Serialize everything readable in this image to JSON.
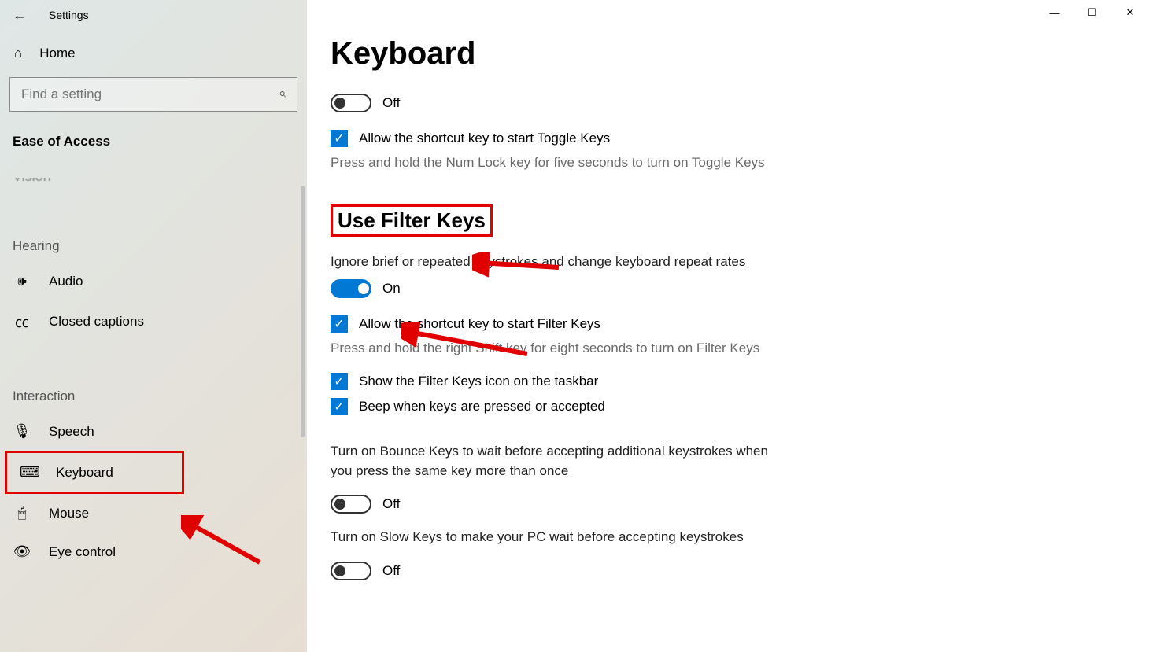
{
  "window": {
    "title": "Settings",
    "minimize": "—",
    "maximize": "☐",
    "close": "✕"
  },
  "sidebar": {
    "home": "Home",
    "search_placeholder": "Find a setting",
    "category": "Ease of Access",
    "vision_cut": "Vision",
    "groups": {
      "hearing": "Hearing",
      "interaction": "Interaction"
    },
    "items": {
      "audio": "Audio",
      "closed_captions": "Closed captions",
      "speech": "Speech",
      "keyboard": "Keyboard",
      "mouse": "Mouse",
      "eye_control": "Eye control"
    }
  },
  "page": {
    "title": "Keyboard",
    "toggle_keys": {
      "state": "Off",
      "allow_shortcut": "Allow the shortcut key to start Toggle Keys",
      "hint": "Press and hold the Num Lock key for five seconds to turn on Toggle Keys"
    },
    "filter_keys": {
      "heading": "Use Filter Keys",
      "desc": "Ignore brief or repeated keystrokes and change keyboard repeat rates",
      "state": "On",
      "allow_shortcut": "Allow the shortcut key to start Filter Keys",
      "hint": "Press and hold the right Shift key for eight seconds to turn on Filter Keys",
      "show_icon": "Show the Filter Keys icon on the taskbar",
      "beep": "Beep when keys are pressed or accepted"
    },
    "bounce_keys": {
      "desc": "Turn on Bounce Keys to wait before accepting additional keystrokes when you press the same key more than once",
      "state": "Off"
    },
    "slow_keys": {
      "desc": "Turn on Slow Keys to make your PC wait before accepting keystrokes",
      "state": "Off"
    }
  }
}
